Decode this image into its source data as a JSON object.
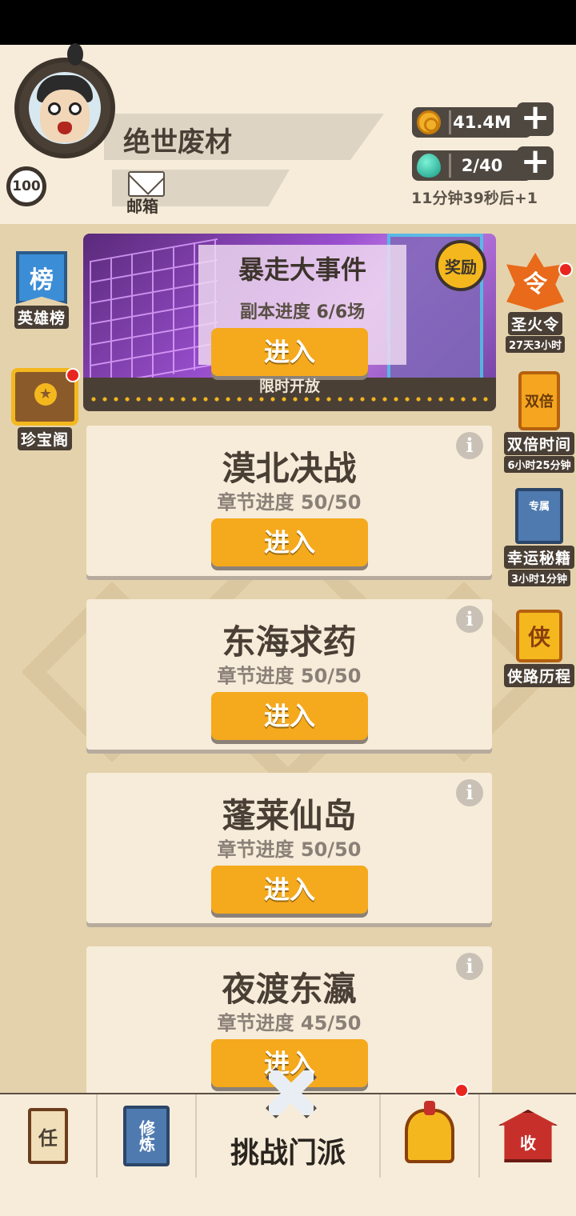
{
  "player": {
    "name": "绝世废材",
    "level": "100"
  },
  "mailbox": {
    "label": "邮箱"
  },
  "resources": {
    "coins": "41.4M",
    "stamina": "2/40",
    "refill_timer": "11分钟39秒后+1"
  },
  "left_side": [
    {
      "icon_text": "榜",
      "label": "英雄榜"
    },
    {
      "label": "珍宝阁",
      "has_dot": true
    }
  ],
  "right_side": [
    {
      "icon_text": "令",
      "label": "圣火令",
      "sub": "27天3小时",
      "has_dot": true
    },
    {
      "icon_text": "双倍",
      "label": "双倍时间",
      "sub": "6小时25分钟"
    },
    {
      "icon_text": "专属",
      "label": "幸运秘籍",
      "sub": "3小时1分钟"
    },
    {
      "icon_text": "侠",
      "label": "侠路历程"
    }
  ],
  "event": {
    "title": "暴走大事件",
    "progress": "副本进度 6/6场",
    "reward_label": "奖励",
    "enter_label": "进入",
    "limited_label": "限时开放"
  },
  "stages": [
    {
      "title": "漠北决战",
      "progress": "章节进度 50/50",
      "enter_label": "进入"
    },
    {
      "title": "东海求药",
      "progress": "章节进度 50/50",
      "enter_label": "进入"
    },
    {
      "title": "蓬莱仙岛",
      "progress": "章节进度 50/50",
      "enter_label": "进入"
    },
    {
      "title": "夜渡东瀛",
      "progress": "章节进度 45/50",
      "enter_label": "进入"
    }
  ],
  "bottom_nav": {
    "task_icon": "任",
    "train_icon": "修炼",
    "challenge_label": "挑战门派",
    "collect_icon": "收"
  },
  "icons": {
    "info": "i",
    "plus": "+"
  },
  "colors": {
    "button_orange": "#f5a91d",
    "red_dot": "#e8261f",
    "background": "#e4d2ac"
  }
}
